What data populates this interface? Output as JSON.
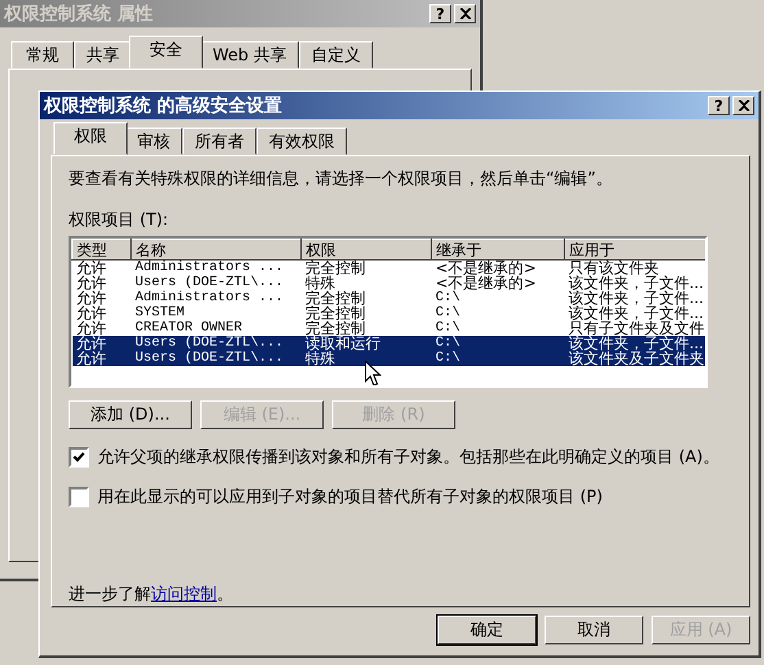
{
  "background_window": {
    "title": "权限控制系统 属性",
    "help": "?",
    "tabs": [
      {
        "label": "常规",
        "selected": false
      },
      {
        "label": "共享",
        "selected": false
      },
      {
        "label": "安全",
        "selected": true
      },
      {
        "label": "Web 共享",
        "selected": false
      },
      {
        "label": "自定义",
        "selected": false
      }
    ]
  },
  "dialog": {
    "title": "权限控制系统 的高级安全设置",
    "help": "?",
    "tabs": [
      {
        "label": "权限",
        "selected": true
      },
      {
        "label": "审核",
        "selected": false
      },
      {
        "label": "所有者",
        "selected": false
      },
      {
        "label": "有效权限",
        "selected": false
      }
    ],
    "instruction": "要查看有关特殊权限的详细信息，请选择一个权限项目，然后单击“编辑”。",
    "list_label": "权限项目 (T):",
    "table": {
      "columns": [
        "类型",
        "名称",
        "权限",
        "继承于",
        "应用于"
      ],
      "rows": [
        {
          "cells": [
            "允许",
            "Administrators ...",
            "完全控制",
            "<不是继承的>",
            "只有该文件夹"
          ],
          "selected": false
        },
        {
          "cells": [
            "允许",
            "Users (DOE-ZTL\\...",
            "特殊",
            "<不是继承的>",
            "该文件夹，子文件..."
          ],
          "selected": false
        },
        {
          "cells": [
            "允许",
            "Administrators ...",
            "完全控制",
            "C:\\",
            "该文件夹，子文件..."
          ],
          "selected": false
        },
        {
          "cells": [
            "允许",
            "SYSTEM",
            "完全控制",
            "C:\\",
            "该文件夹，子文件..."
          ],
          "selected": false
        },
        {
          "cells": [
            "允许",
            "CREATOR OWNER",
            "完全控制",
            "C:\\",
            "只有子文件夹及文件"
          ],
          "selected": false
        },
        {
          "cells": [
            "允许",
            "Users (DOE-ZTL\\...",
            "读取和运行",
            "C:\\",
            "该文件夹，子文件..."
          ],
          "selected": true
        },
        {
          "cells": [
            "允许",
            "Users (DOE-ZTL\\...",
            "特殊",
            "C:\\",
            "该文件夹及子文件夹"
          ],
          "selected": true
        }
      ]
    },
    "buttons": [
      {
        "label": "添加 (D)...",
        "disabled": false
      },
      {
        "label": "编辑 (E)...",
        "disabled": true
      },
      {
        "label": "删除 (R)",
        "disabled": true
      }
    ],
    "checkboxes": [
      {
        "label": "允许父项的继承权限传播到该对象和所有子对象。包括那些在此明确定义的项目 (A)。",
        "checked": true
      },
      {
        "label": "用在此显示的可以应用到子对象的项目替代所有子对象的权限项目 (P)",
        "checked": false
      }
    ],
    "learn_more": {
      "text": "进一步了解",
      "link": "访问控制",
      "end": "。"
    },
    "footer_buttons": [
      {
        "label": "确定",
        "disabled": false,
        "default": true
      },
      {
        "label": "取消",
        "disabled": false,
        "default": false
      },
      {
        "label": "应用 (A)",
        "disabled": true,
        "default": false
      }
    ]
  }
}
